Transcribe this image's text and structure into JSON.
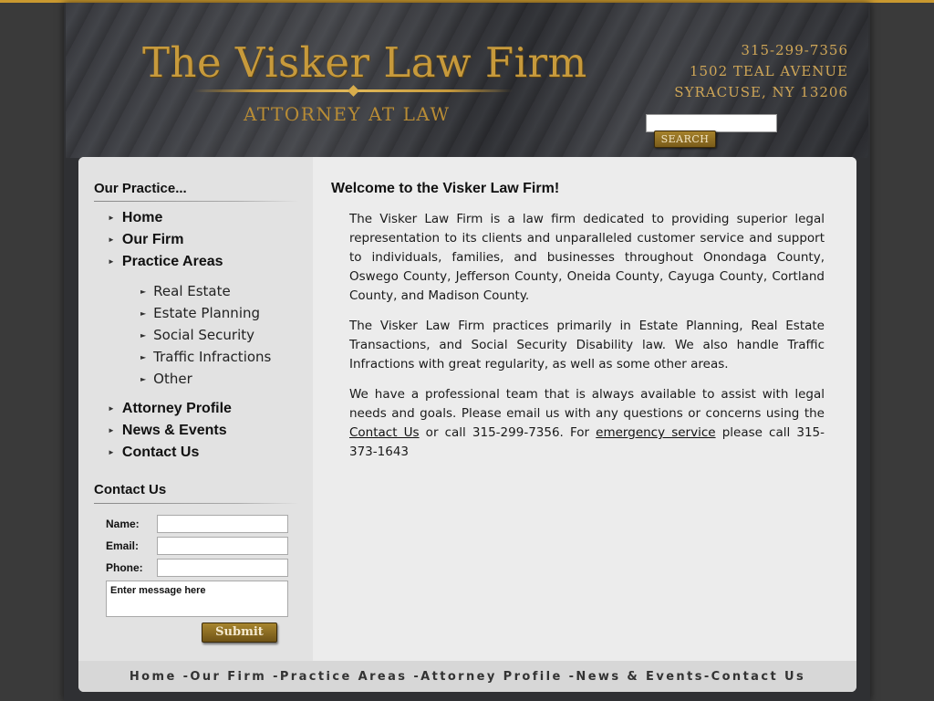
{
  "header": {
    "title": "The Visker Law Firm",
    "subtitle": "ATTORNEY AT LAW",
    "phone": "315-299-7356",
    "address_line1": "1502 TEAL AVENUE",
    "address_line2": "SYRACUSE, NY 13206",
    "search_button": "SEARCH",
    "search_value": ""
  },
  "sidebar": {
    "practice_heading": "Our Practice...",
    "nav": [
      {
        "label": "Home"
      },
      {
        "label": "Our Firm"
      },
      {
        "label": "Practice Areas"
      }
    ],
    "sub_nav": [
      {
        "label": "Real Estate"
      },
      {
        "label": "Estate Planning"
      },
      {
        "label": "Social Security"
      },
      {
        "label": "Traffic Infractions"
      },
      {
        "label": "Other"
      }
    ],
    "nav_lower": [
      {
        "label": "Attorney Profile"
      },
      {
        "label": "News & Events"
      },
      {
        "label": "Contact Us"
      }
    ],
    "contact_heading": "Contact Us",
    "form": {
      "name_label": "Name:",
      "email_label": "Email:",
      "phone_label": "Phone:",
      "message_placeholder": "Enter message here",
      "submit_label": "Submit"
    }
  },
  "main": {
    "heading": "Welcome to the Visker Law Firm!",
    "para1": "The Visker Law Firm is a law firm dedicated to providing superior legal representation to its clients and unparalleled customer service and support to individuals, families, and businesses throughout Onondaga County, Oswego County, Jefferson County, Oneida County, Cayuga County, Cortland County, and Madison County.",
    "para2": "The Visker Law Firm practices primarily in Estate Planning, Real Estate Transactions, and Social Security Disability law. We also handle Traffic Infractions with great regularity, as well as some other areas.",
    "para3_a": "We have a professional team that is always available to assist with legal needs and goals. Please email us with any questions or concerns using the ",
    "para3_link1": "Contact Us",
    "para3_b": " or call 315-299-7356. For ",
    "para3_link2": "emergency service",
    "para3_c": " please call 315-373-1643"
  },
  "footer": {
    "links": [
      "Home ",
      "-Our Firm ",
      "-Practice Areas ",
      "-Attorney Profile ",
      "-News & Events",
      "-Contact Us"
    ]
  },
  "colors": {
    "accent_gold": "#c79a3c",
    "top_strip": "#c9982f",
    "page_bg": "#3a3a3a"
  }
}
